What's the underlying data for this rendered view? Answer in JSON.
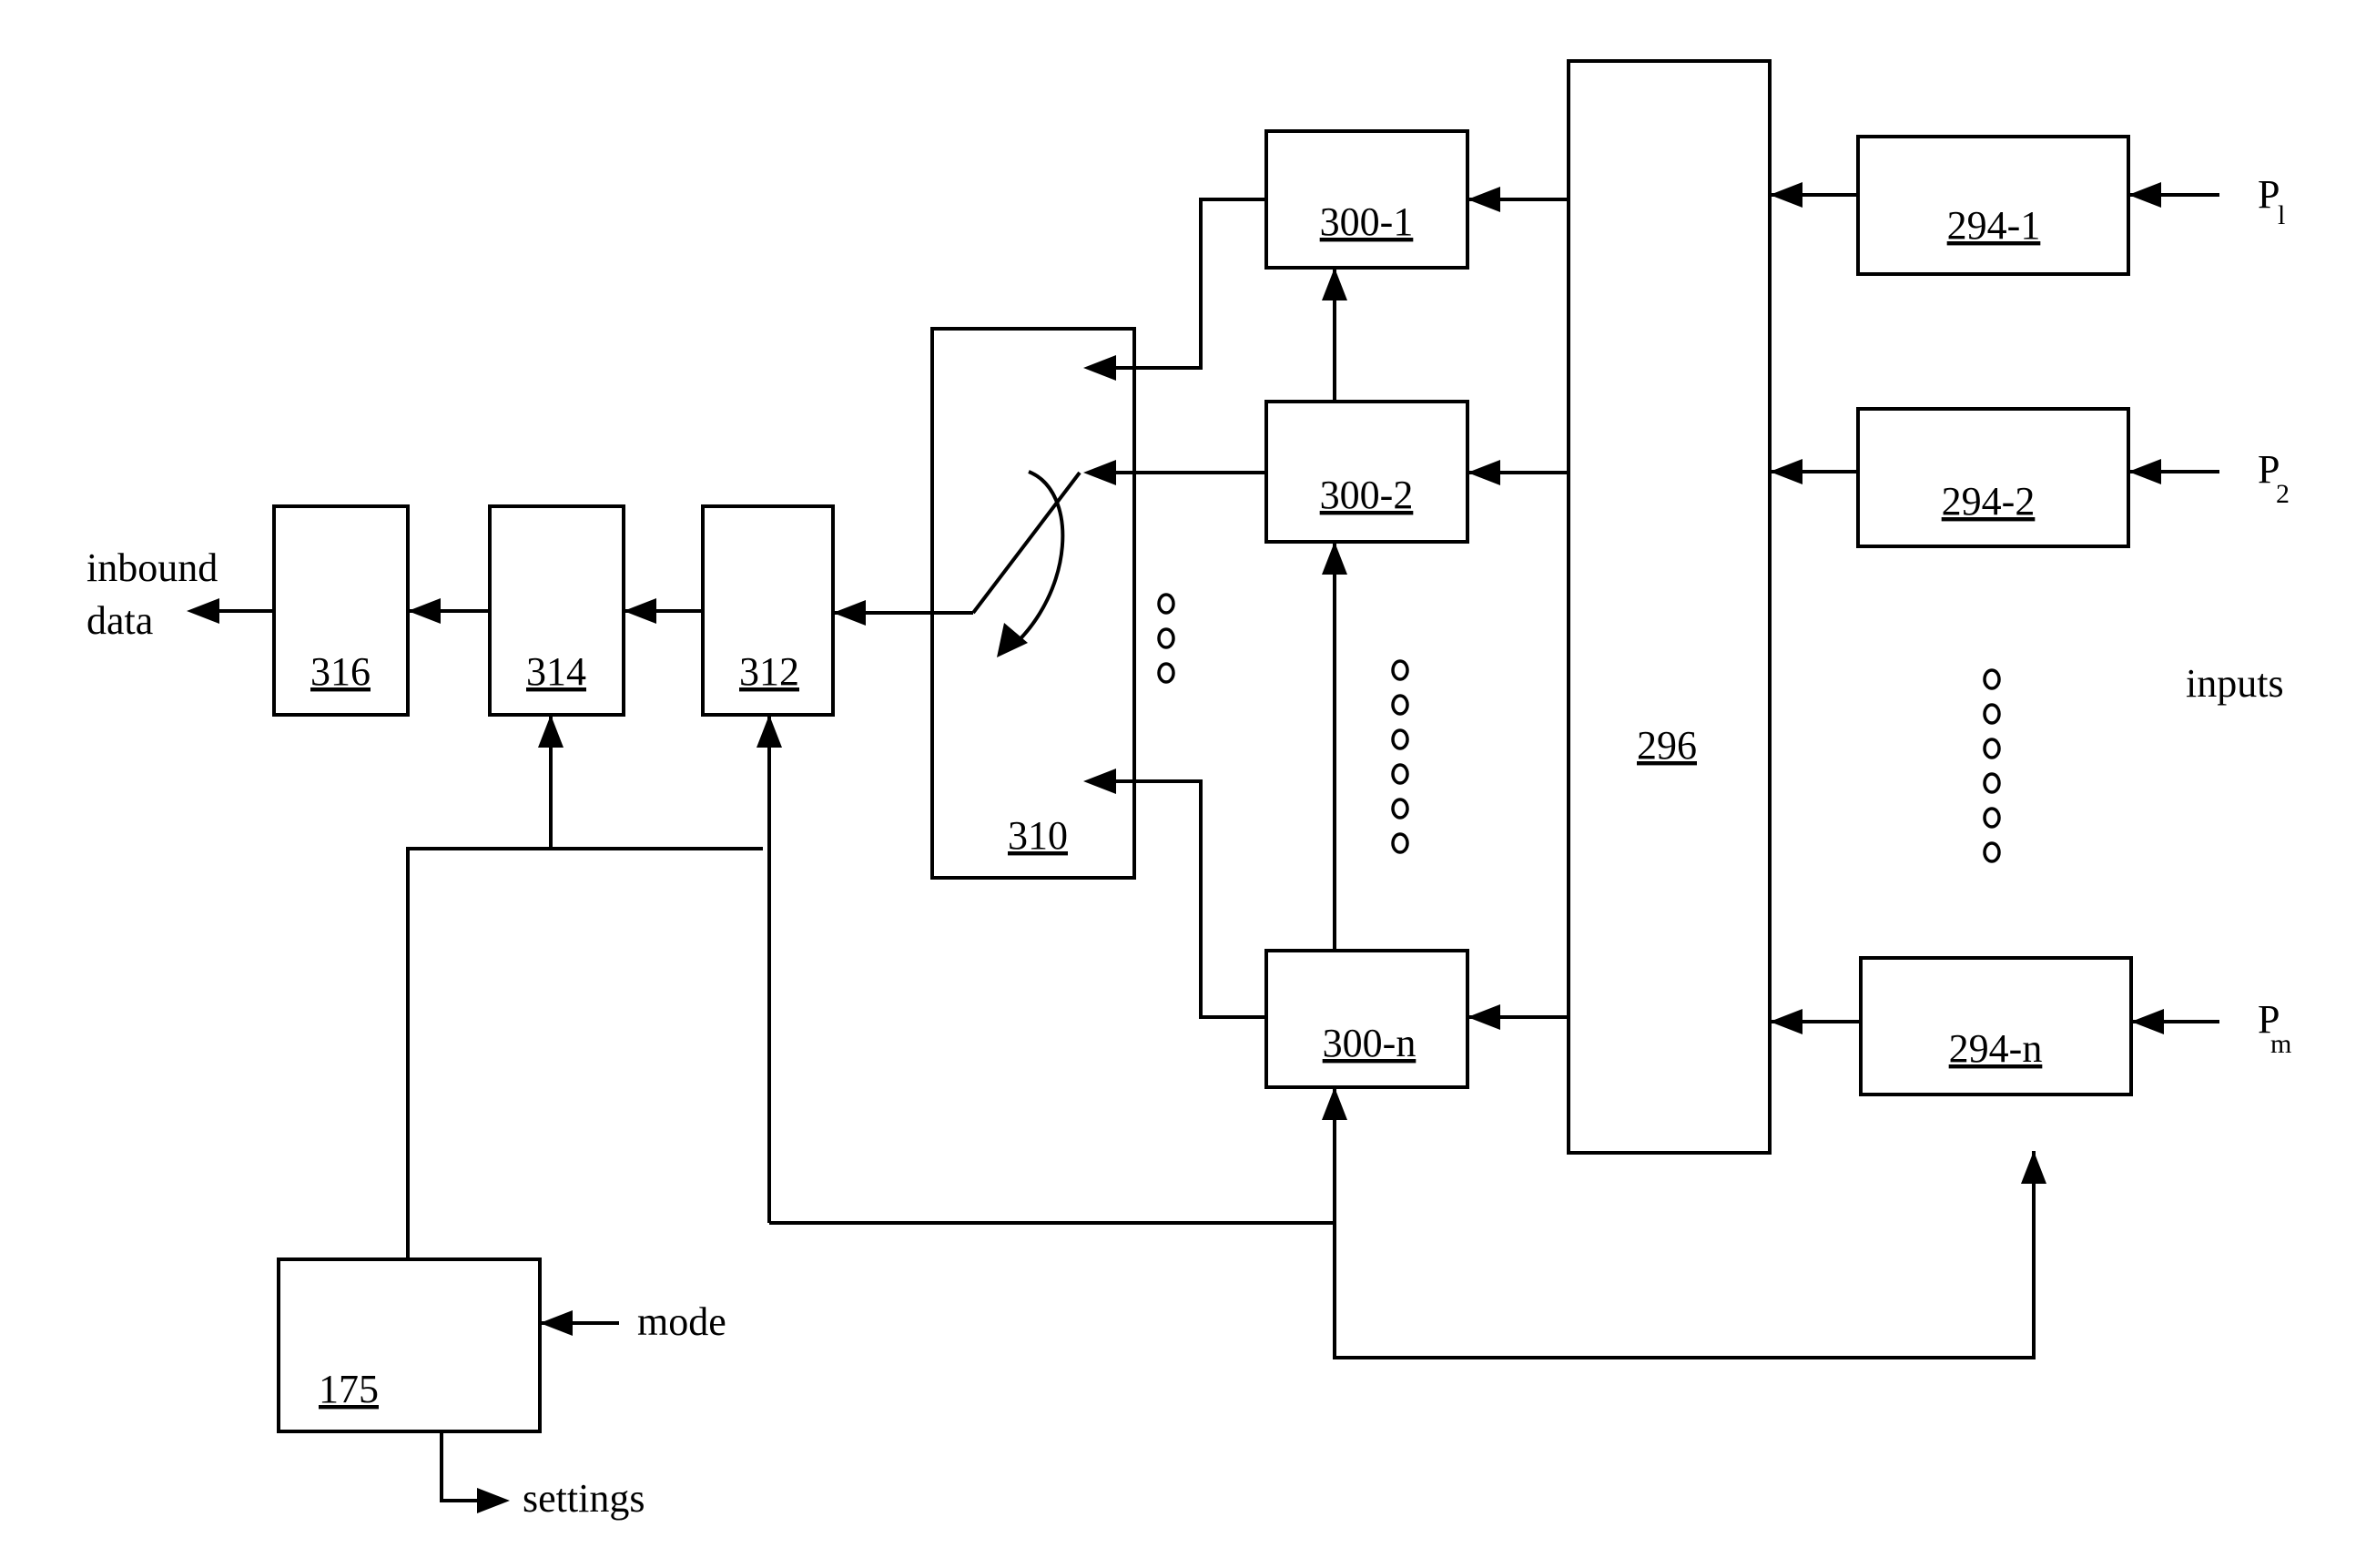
{
  "figure": {
    "blocks": [
      {
        "id": "316",
        "label": "316"
      },
      {
        "id": "314",
        "label": "314"
      },
      {
        "id": "312",
        "label": "312"
      },
      {
        "id": "310",
        "label": "310"
      },
      {
        "id": "300-1",
        "label": "300-1"
      },
      {
        "id": "300-2",
        "label": "300-2"
      },
      {
        "id": "300-n",
        "label": "300-n"
      },
      {
        "id": "296",
        "label": "296"
      },
      {
        "id": "294-1",
        "label": "294-1"
      },
      {
        "id": "294-2",
        "label": "294-2"
      },
      {
        "id": "294-n",
        "label": "294-n"
      },
      {
        "id": "175",
        "label": "175"
      }
    ],
    "text_labels": {
      "inbound_line1": "inbound",
      "inbound_line2": "data",
      "inputs": "inputs",
      "mode": "mode",
      "settings": "settings",
      "p1_base": "P",
      "p1_sub": "l",
      "p2_base": "P",
      "p2_sub": "2",
      "pm_base": "P",
      "pm_sub": "m"
    },
    "ellipsis_counts": {
      "switch_inputs": 3,
      "processors": 6,
      "input_ports": 6
    },
    "line_color": "#000000",
    "background": "#ffffff"
  }
}
